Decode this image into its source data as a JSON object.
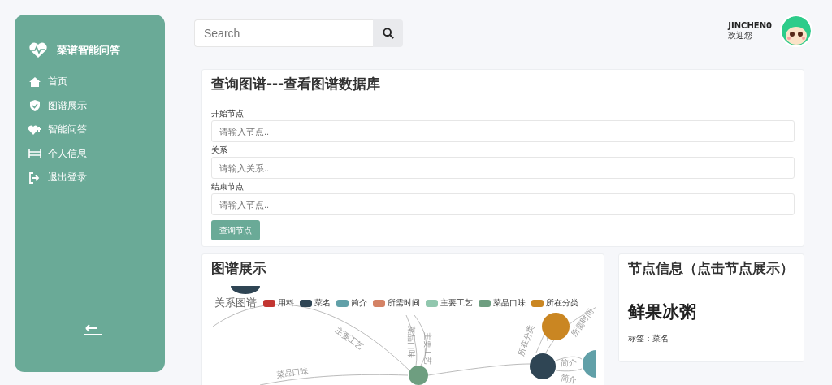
{
  "sidebar": {
    "title": "菜谱智能问答",
    "items": [
      {
        "label": "首页"
      },
      {
        "label": "图谱展示"
      },
      {
        "label": "智能问答"
      },
      {
        "label": "个人信息"
      },
      {
        "label": "退出登录"
      }
    ]
  },
  "search": {
    "placeholder": "Search"
  },
  "user": {
    "name": "JINCHEN0",
    "greeting": "欢迎您"
  },
  "query_card": {
    "title": "查询图谱---查看图谱数据库",
    "fields": [
      {
        "label": "开始节点",
        "placeholder": "请输入节点.."
      },
      {
        "label": "关系",
        "placeholder": "请输入关系.."
      },
      {
        "label": "结束节点",
        "placeholder": "请输入节点.."
      }
    ],
    "button": "查询节点"
  },
  "graph_card": {
    "title": "图谱展示",
    "graph_title": "关系图谱",
    "legend": [
      {
        "label": "用料",
        "color": "#c23531"
      },
      {
        "label": "菜名",
        "color": "#2f4554"
      },
      {
        "label": "简介",
        "color": "#61a0a8"
      },
      {
        "label": "所需时间",
        "color": "#d48265"
      },
      {
        "label": "主要工艺",
        "color": "#91c7ae"
      },
      {
        "label": "菜品口味",
        "color": "#6e9e80"
      },
      {
        "label": "所在分类",
        "color": "#ca8622"
      }
    ],
    "edge_labels": [
      "主要工艺",
      "菜品口味",
      "主要工艺",
      "所在分类",
      "简介",
      "简介",
      "所需时间",
      "菜品口味"
    ]
  },
  "node_card": {
    "title": "节点信息（点击节点展示）",
    "node_name": "鲜果冰粥",
    "tag_label": "标签：",
    "tag_value": "菜名"
  }
}
